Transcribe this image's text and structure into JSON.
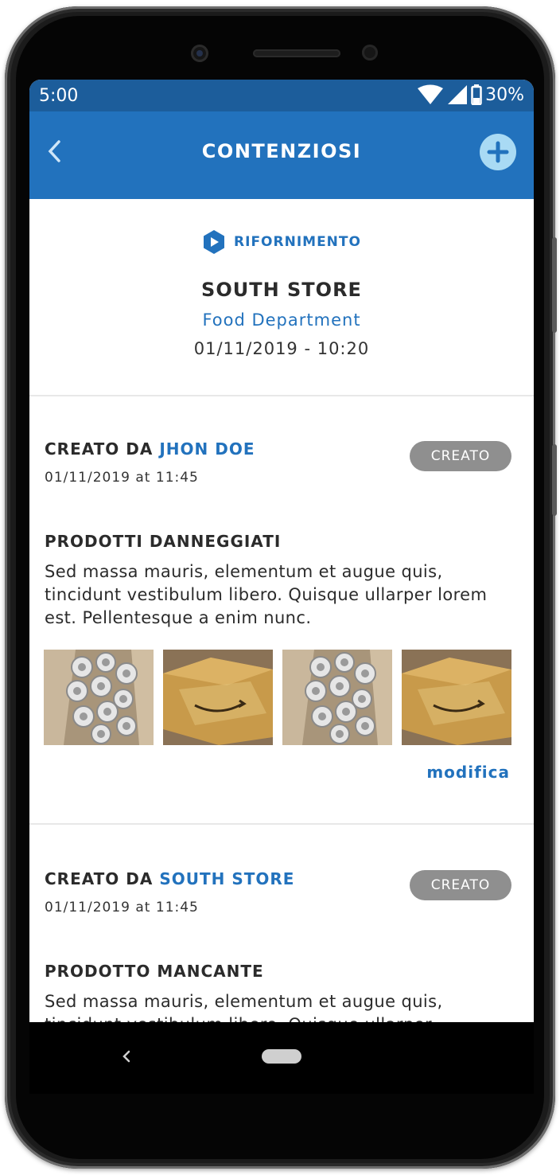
{
  "status_bar": {
    "time": "5:00",
    "battery": "30%"
  },
  "app_bar": {
    "title": "CONTENZIOSI"
  },
  "header": {
    "type_label": "RIFORNIMENTO",
    "store_name": "SOUTH STORE",
    "department": "Food Department",
    "datetime": "01/11/2019 - 10:20"
  },
  "entries": [
    {
      "created_prefix": "CREATO DA",
      "author": "JHON DOE",
      "created_at": "01/11/2019 at 11:45",
      "status": "CREATO",
      "title": "PRODOTTI DANNEGGIATI",
      "description": "Sed massa mauris, elementum et augue quis, tincidunt vestibulum libero. Quisque ullarper lorem est. Pellentesque a enim nunc.",
      "edit_label": "modifica"
    },
    {
      "created_prefix": "CREATO DA",
      "author": "SOUTH STORE",
      "created_at": "01/11/2019 at 11:45",
      "status": "CREATO",
      "title": "PRODOTTO MANCANTE",
      "description": "Sed massa mauris, elementum et augue quis, tincidunt vestibulum libero. Quisque ullarper"
    }
  ],
  "colors": {
    "primary": "#2272bd",
    "status_bar": "#1c5d9b",
    "badge": "#8f8f8f",
    "add_button": "#a9daf4"
  },
  "icons": [
    "back-arrow-icon",
    "plus-icon",
    "hexagon-play-icon",
    "wifi-icon",
    "signal-icon",
    "battery-icon"
  ]
}
